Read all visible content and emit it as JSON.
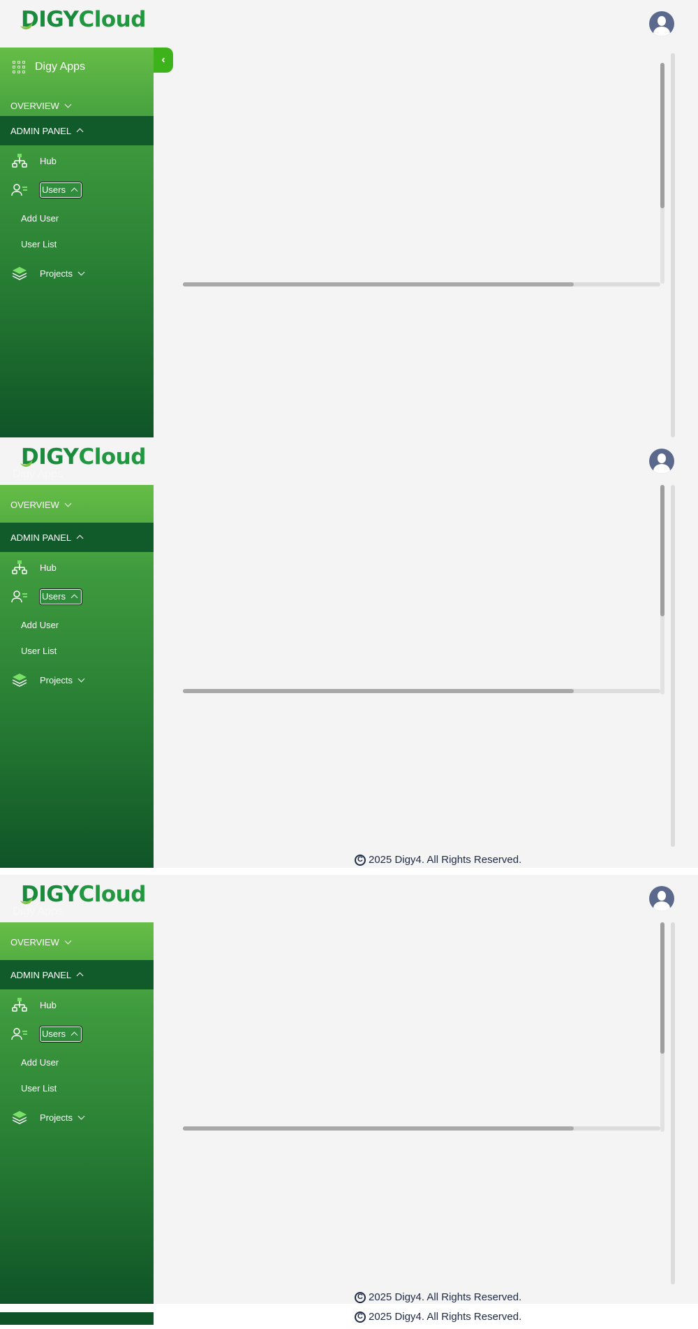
{
  "brand": {
    "logo_d": "D",
    "logo_igy": "IGY",
    "logo_cloud": "Cloud"
  },
  "colors": {
    "accent": "#3db31b",
    "sidebar_top": "#66bd46",
    "sidebar_bottom": "#0f5427",
    "admin_bg": "#115a29",
    "logo_green": "#1a8a3c"
  },
  "sidebar": {
    "apps_label": "Digy Apps",
    "overview_label": "OVERVIEW",
    "admin_label": "ADMIN PANEL",
    "hub_label": "Hub",
    "users_label": "Users",
    "add_user_label": "Add User",
    "user_list_label": "User List",
    "projects_label": "Projects",
    "collapse_glyph": "‹"
  },
  "icons": [
    "grid-icon",
    "chevron-down-icon",
    "chevron-up-icon",
    "hub-network-icon",
    "users-icon",
    "layers-icon",
    "user-avatar-icon",
    "copyright-icon"
  ],
  "footer": {
    "copyright_symbol": "C",
    "text": "2025 Digy4. All Rights Reserved."
  }
}
